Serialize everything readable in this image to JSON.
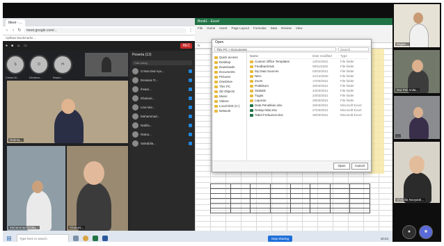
{
  "browser": {
    "tab_label": "Meet - ...",
    "url": "meet.google.com/...",
    "bookmarks": "Aplikasi   Bookmarks   ...",
    "meet_record_label": "REC"
  },
  "avatars": [
    {
      "initial": "S",
      "name": "Crissa M..."
    },
    {
      "initial": "D",
      "name": "Deviana..."
    },
    {
      "initial": "H",
      "name": "Ihsani..."
    }
  ],
  "video_tiles": [
    {
      "label": "Rahma..."
    },
    {
      "label": "Khairuni..."
    },
    {
      "label": "Muhammad Dzaky..."
    }
  ],
  "panel": {
    "title": "Peserta (12)",
    "search_placeholder": "Cari orang",
    "participants": [
      "Crissa Dwi Ayu...",
      "Deviana Tr...",
      "Ihsani...",
      "Khairuni...",
      "Lina Nur...",
      "Muhammad...",
      "Nabila...",
      "Ratna...",
      "Salsabila..."
    ]
  },
  "excel": {
    "title": "Book1 - Excel",
    "ribbon": [
      "File",
      "Home",
      "Insert",
      "Page Layout",
      "Formulas",
      "Data",
      "Review",
      "View"
    ],
    "formula": "fx"
  },
  "dialog": {
    "title": "Open",
    "path": "This PC > Documents",
    "search_placeholder": "Search",
    "nav": [
      "Quick access",
      "Desktop",
      "Downloads",
      "Documents",
      "Pictures",
      "OneDrive",
      "This PC",
      "3D Objects",
      "Music",
      "Videos",
      "Local Disk (C:)",
      "Network"
    ],
    "columns": [
      "Name",
      "Date modified",
      "Type"
    ],
    "files": [
      {
        "name": "Custom Office Templates",
        "date": "12/01/2021",
        "type": "File folder"
      },
      {
        "name": "FeedbackHub",
        "date": "09/11/2020",
        "type": "File folder"
      },
      {
        "name": "My Data Sources",
        "date": "03/02/2021",
        "type": "File folder"
      },
      {
        "name": "Nitro",
        "date": "21/12/2020",
        "type": "File folder"
      },
      {
        "name": "Zoom",
        "date": "17/03/2021",
        "type": "File folder"
      },
      {
        "name": "Praktikum",
        "date": "20/03/2021",
        "type": "File folder"
      },
      {
        "name": "Statistik",
        "date": "22/03/2021",
        "type": "File folder"
      },
      {
        "name": "Tugas",
        "date": "24/03/2021",
        "type": "File folder"
      },
      {
        "name": "Laporan",
        "date": "25/03/2021",
        "type": "File folder"
      },
      {
        "name": "Data Penelitian.xlsx",
        "date": "26/03/2021",
        "type": "Microsoft Excel"
      },
      {
        "name": "Rekap Nilai.xlsx",
        "date": "27/03/2021",
        "type": "Microsoft Excel"
      },
      {
        "name": "Tabel Frekuensi.xlsx",
        "date": "28/03/2021",
        "type": "Microsoft Excel"
      }
    ],
    "open_label": "Open",
    "cancel_label": "Cancel"
  },
  "taskbar": {
    "search_placeholder": "Type here to search",
    "share_label": "Stop sharing",
    "clock": "10:24"
  },
  "filmstrip": [
    {
      "label": "Bagas..."
    },
    {
      "label": "Dwi Fitri Anita..."
    },
    {
      "label": "..."
    },
    {
      "label": "Chindita Novyanti..."
    }
  ]
}
